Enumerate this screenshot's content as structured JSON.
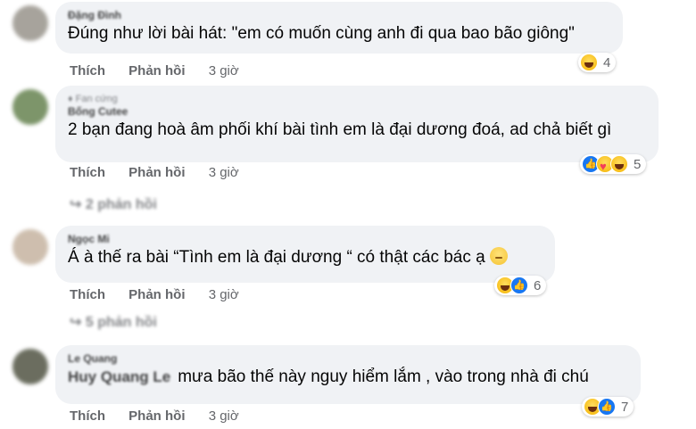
{
  "comments": [
    {
      "author": "Đặng Đình",
      "text": "Đúng như lời bài hát: \"em có muốn cùng anh đi qua bao bão giông\"",
      "actions": {
        "like": "Thích",
        "reply": "Phản hồi",
        "time": "3 giờ"
      },
      "reaction_count": "4",
      "reactions": [
        "haha-icon"
      ]
    },
    {
      "badge": "Fan cứng",
      "author": "Bống Cutee",
      "text": "2 bạn đang hoà âm phối khí bài tình em là đại dương đoá, ad chả biết gì",
      "actions": {
        "like": "Thích",
        "reply": "Phản hồi",
        "time": "3 giờ"
      },
      "reaction_count": "5",
      "reactions": [
        "like-icon",
        "care-icon",
        "haha-icon"
      ],
      "replies": "2 phản hồi"
    },
    {
      "author": "Ngọc Mi",
      "text": "Á à thế ra bài “Tình em là đại dương “ có thật các bác ạ",
      "actions": {
        "like": "Thích",
        "reply": "Phản hồi",
        "time": "3 giờ"
      },
      "reaction_count": "6",
      "reactions": [
        "haha-icon",
        "like-icon"
      ],
      "replies": "5 phản hồi"
    },
    {
      "author": "Le Quang",
      "tagged": "Huy Quang Le",
      "text": "mưa bão thế này nguy hiểm lắm , vào trong nhà đi chú",
      "actions": {
        "like": "Thích",
        "reply": "Phản hồi",
        "time": "3 giờ"
      },
      "reaction_count": "7",
      "reactions": [
        "haha-icon",
        "like-icon"
      ]
    }
  ]
}
